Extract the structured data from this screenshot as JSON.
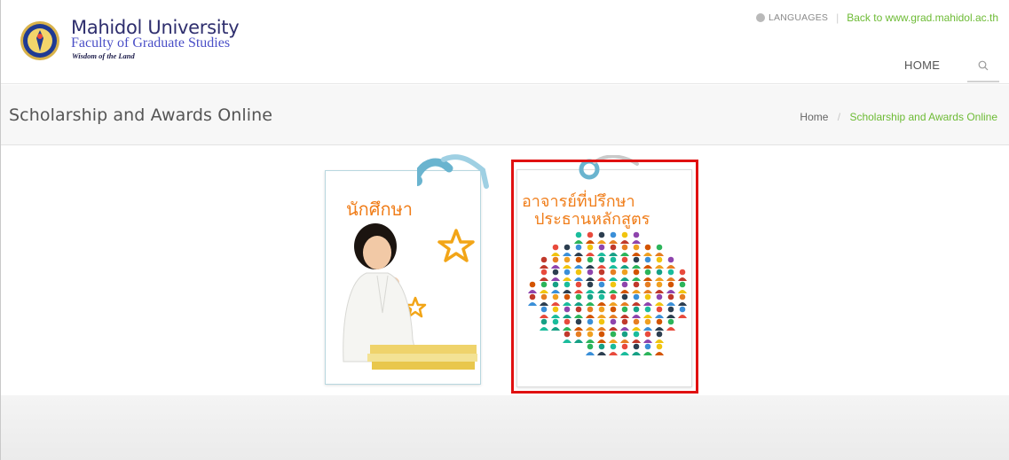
{
  "header": {
    "university_name": "Mahidol University",
    "faculty_name": "Faculty of Graduate Studies",
    "motto": "Wisdom of the Land",
    "languages_label": "LANGUAGES",
    "back_link": "Back to www.grad.mahidol.ac.th",
    "nav_home": "HOME",
    "icons": [
      "university-seal-logo",
      "globe-icon",
      "search-icon"
    ]
  },
  "titlebar": {
    "page_title": "Scholarship and Awards Online",
    "breadcrumb": {
      "home": "Home",
      "current": "Scholarship and Awards Online"
    }
  },
  "cards": [
    {
      "label": "นักศึกษา"
    },
    {
      "label_line1": "อาจารย์ที่ปรึกษา",
      "label_line2": "ประธานหลักสูตร",
      "highlighted": true
    }
  ],
  "colors": {
    "accent_green": "#6dbb35",
    "brand_navy": "#2f2f6e",
    "card_label_orange": "#f07d19",
    "ribbon_teal": "#6ab4cf",
    "highlight_red": "#e01010"
  }
}
